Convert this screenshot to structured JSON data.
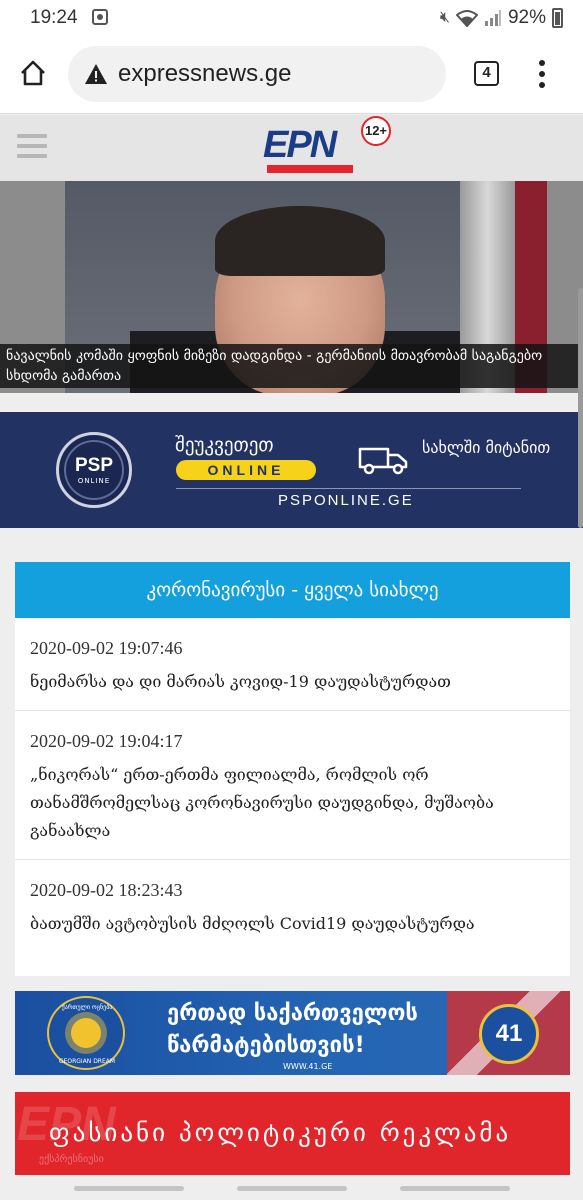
{
  "status_bar": {
    "time": "19:24",
    "battery": "92%"
  },
  "browser": {
    "url": "expressnews.ge",
    "tab_count": "4"
  },
  "site": {
    "logo": "EPN",
    "logo_sub": "ექსპრესნიუსი",
    "age_rating": "12+"
  },
  "hero": {
    "caption": "ნავალნის კომაში ყოფნის მიზეზი დადგინდა - გერმანიის მთავრობამ საგანგებო სხდომა გამართა"
  },
  "psp_ad": {
    "logo": "PSP",
    "logo_sub": "ONLINE",
    "line1": "შეუკვეთეთ",
    "badge": "ONLINE",
    "delivery": "სახლში მიტანით",
    "url": "PSPONLINE.GE"
  },
  "covid": {
    "header": "კორონავირუსი - ყველა სიახლე",
    "items": [
      {
        "date": "2020-09-02 19:07:46",
        "title": "ნეიმარსა და დი მარიას კოვიდ-19 დაუდასტურდათ"
      },
      {
        "date": "2020-09-02 19:04:17",
        "title": "„ნიკორას“ ერთ-ერთმა ფილიალმა, რომლის ორ თანამშრომელსაც კორონავირუსი დაუდგინდა, მუშაობა განაახლა"
      },
      {
        "date": "2020-09-02 18:23:43",
        "title": "ბათუმში ავტობუსის მძღოლს Covid19 დაუდასტურდა"
      }
    ]
  },
  "gd_ad": {
    "logo_top": "ქართული ოცნება",
    "logo_bottom": "GEORGIAN DREAM",
    "line1": "ერთად საქართველოს",
    "line2": "წარმატებისთვის!",
    "url": "WWW.41.GE",
    "number": "41"
  },
  "paid_ad": {
    "text": "ფასიანი პოლიტიკური რეკლამა",
    "ghost": "EPN",
    "sub": "ექსპრესნიუსი"
  },
  "colors": {
    "accent": "#13a0dc",
    "brand_blue": "#1b3c86",
    "brand_red": "#e3262e",
    "ad_red": "#e1262b",
    "psp_navy": "#223363"
  }
}
